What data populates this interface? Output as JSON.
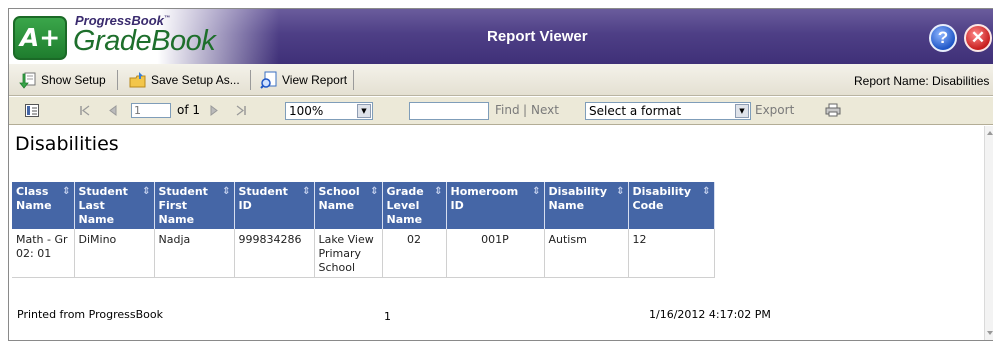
{
  "app": {
    "logo_top": "ProgressBook",
    "logo_tm": "™",
    "logo_main": "GradeBook",
    "logo_badge": "A+",
    "title": "Report Viewer",
    "help_glyph": "?",
    "close_glyph": "✕"
  },
  "toolbar": {
    "show_setup": "Show Setup",
    "save_setup": "Save Setup As...",
    "view_report": "View Report",
    "report_name": "Report Name: Disabilities"
  },
  "viewer": {
    "page_value": "1",
    "of_pages": "of 1",
    "zoom": "100%",
    "find": "Find",
    "find_sep": "|",
    "next": "Next",
    "format": "Select a format",
    "export": "Export"
  },
  "report": {
    "title": "Disabilities",
    "columns": [
      [
        "Class",
        "Name",
        ""
      ],
      [
        "Student",
        "Last",
        "Name"
      ],
      [
        "Student",
        "First",
        "Name"
      ],
      [
        "Student",
        "ID",
        ""
      ],
      [
        "School",
        "Name",
        ""
      ],
      [
        "Grade",
        "Level",
        "Name"
      ],
      [
        "Homeroom",
        "ID",
        ""
      ],
      [
        "Disability",
        "Name",
        ""
      ],
      [
        "Disability",
        "Code",
        ""
      ]
    ],
    "row": {
      "class_name_1": "Math - Gr",
      "class_name_2": "02: 01",
      "last_name": "DiMino",
      "first_name": "Nadja",
      "student_id": "999834286",
      "school_1": "Lake View",
      "school_2": "Primary",
      "school_3": "School",
      "grade": "02",
      "homeroom": "001P",
      "disability_name": "Autism",
      "disability_code": "12"
    },
    "footer": {
      "printed": "Printed from ProgressBook",
      "page": "1",
      "datetime": "1/16/2012 4:17:02 PM"
    }
  },
  "colors": {
    "header": "#4e3f86",
    "table_header": "#4566a6",
    "logo_green": "#1e6f2c"
  }
}
